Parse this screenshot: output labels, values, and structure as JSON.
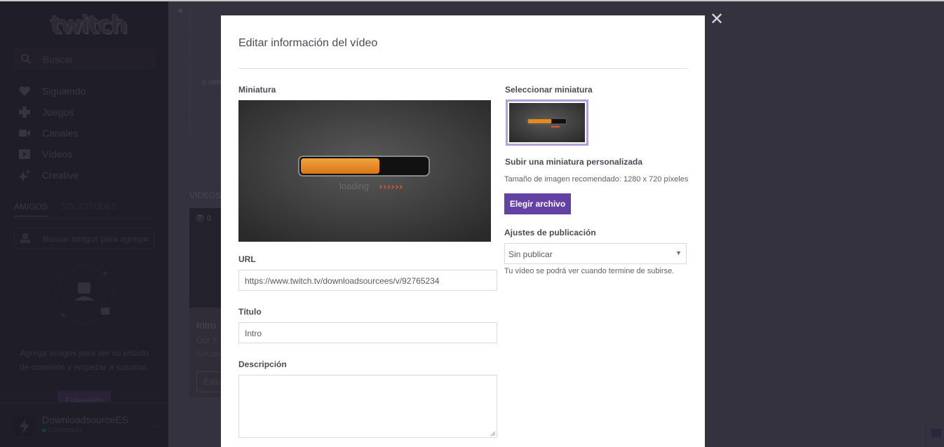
{
  "sidebar": {
    "logo": "twitch",
    "search_placeholder": "Buscar",
    "nav": [
      {
        "label": "Siguiendo",
        "icon": "heart-icon"
      },
      {
        "label": "Juegos",
        "icon": "gamepad-icon"
      },
      {
        "label": "Canales",
        "icon": "camera-icon"
      },
      {
        "label": "Vídeos",
        "icon": "play-icon"
      },
      {
        "label": "Creative",
        "icon": "sparkle-icon"
      }
    ],
    "tabs": [
      {
        "label": "AMIGOS",
        "active": true
      },
      {
        "label": "SOLICITUDES",
        "active": false
      }
    ],
    "friend_search_placeholder": "Buscar amigos para agregar",
    "friends_empty_message": "Agrega amigos para ver su estado de conexión y empezar a susurrar.",
    "got_it_label": "Entendido",
    "user": {
      "name": "DownloadsourceES",
      "status": "Conectado"
    }
  },
  "background": {
    "select_text": "o sele",
    "videos_heading": "VÍDEOS",
    "video_card": {
      "views": "0",
      "title": "Intro",
      "date": "Oct 3,",
      "description": "Sin de",
      "edit_label": "Edita"
    }
  },
  "modal": {
    "title": "Editar información del vídeo",
    "close_label": "✕",
    "thumbnail_label": "Miniatura",
    "thumbnail_image": {
      "caption": "loading",
      "arrows": "››››››",
      "progress": 0.62
    },
    "select_thumbnail_label": "Seleccionar miniatura",
    "upload_custom_label": "Subir una miniatura personalizada",
    "recommended_size": "Tamaño de imagen recomendado: 1280 x 720 píxeles",
    "choose_file_label": "Elegir archivo",
    "publish_settings_label": "Ajustes de publicación",
    "publish_selected": "Sin publicar",
    "publish_hint": "Tu vídeo se podrá ver cuando termine de subirse.",
    "url_label": "URL",
    "url_value": "https://www.twitch.tv/downloadsourcees/v/92765234",
    "title_label": "Título",
    "title_value": "Intro",
    "description_label": "Descripción",
    "description_value": ""
  },
  "colors": {
    "accent": "#6441a4",
    "selected_border": "#b2a0da",
    "progress_orange": "#e58a1f",
    "arrows_red": "#e0552c"
  }
}
